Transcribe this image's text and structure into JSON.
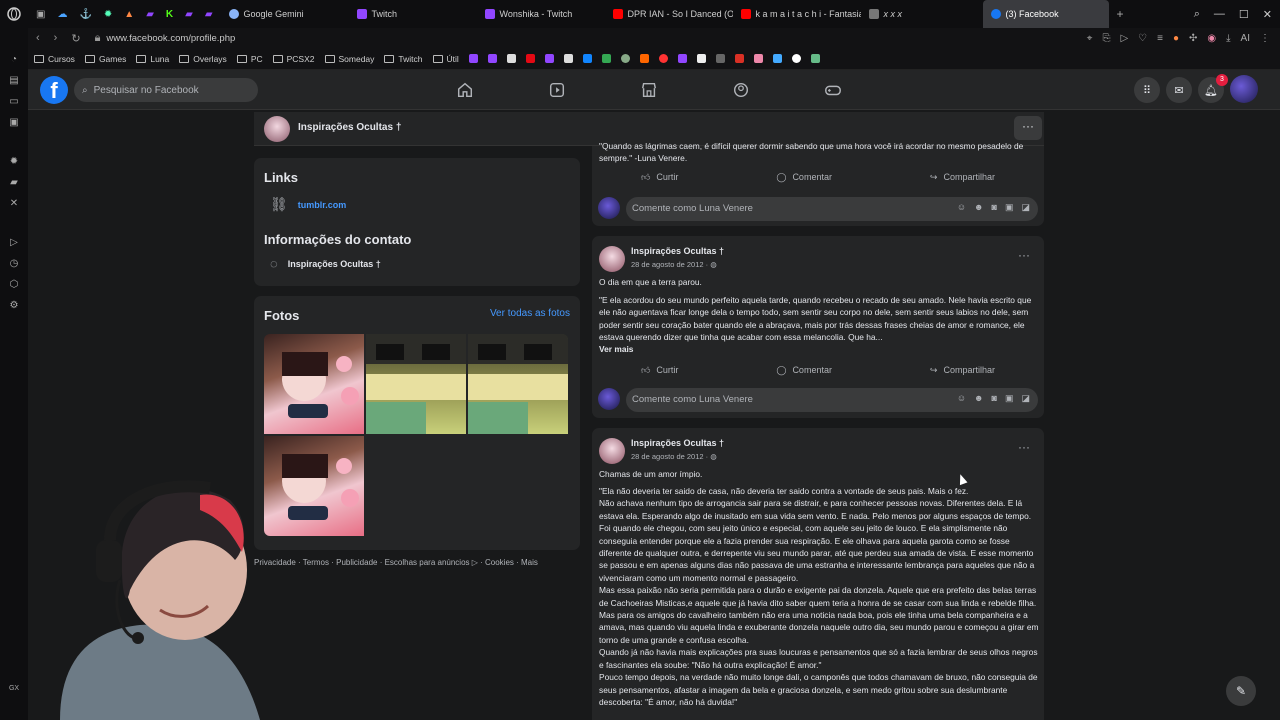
{
  "browser": {
    "tabs": [
      {
        "label": "Google Gemini",
        "color": "#8ab4f8"
      },
      {
        "label": "Twitch",
        "color": "#9146ff"
      },
      {
        "label": "Wonshika - Twitch",
        "color": "#9146ff"
      },
      {
        "label": "DPR IAN - So I Danced (O...",
        "color": "#ff0000"
      },
      {
        "label": "k a m a i t a c h i - Fantasia",
        "color": "#ff0000"
      },
      {
        "label": "x x x",
        "color": "#777777"
      },
      {
        "label": "(3) Facebook",
        "color": "#1877f2"
      }
    ],
    "url": "www.facebook.com/profile.php",
    "bookmarks": [
      "Cursos",
      "Games",
      "Luna",
      "Overlays",
      "PC",
      "PCSX2",
      "Someday",
      "Twitch",
      "Útil"
    ],
    "ai_label": "AI",
    "sidebar_label": "GX"
  },
  "facebook": {
    "search_placeholder": "Pesquisar no Facebook",
    "notification_count": "3",
    "profile_name": "Inspirações Ocultas †",
    "links": {
      "title": "Links",
      "url": "tumblr.com"
    },
    "contact": {
      "title": "Informações do contato",
      "messenger": "Inspirações Ocultas †"
    },
    "photos": {
      "title": "Fotos",
      "see_all": "Ver todas as fotos"
    },
    "footer": "Privacidade · Termos · Publicidade · Escolhas para anúncios ▷ · Cookies · Mais",
    "actions": {
      "like": "Curtir",
      "comment": "Comentar",
      "share": "Compartilhar"
    },
    "comment_placeholder": "Comente como Luna Venere",
    "posts": [
      {
        "text": "\"Quando as lágrimas caem, é difícil querer dormir sabendo que uma hora você irá acordar no mesmo pesadelo de sempre.\" -Luna Venere."
      },
      {
        "author": "Inspirações Ocultas †",
        "date": "28 de agosto de 2012 ·",
        "title": "O dia em que a terra parou.",
        "body": "\"E ela acordou do seu mundo perfeito aquela tarde, quando recebeu o recado de seu amado. Nele havia escrito que ele não aguentava ficar longe dela o tempo todo, sem sentir seu corpo no dele, sem sentir seus labios no dele, sem poder sentir seu coração bater quando ele a abraçava, mais por trás dessas frases cheias de amor e romance, ele estava querendo dizer que tinha que acabar com essa melancolia. Que ha...",
        "see_more": "Ver mais"
      },
      {
        "author": "Inspirações Ocultas †",
        "date": "28 de agosto de 2012 ·",
        "title": "Chamas de um amor ímpio.",
        "paragraphs": [
          "\"Ela não deveria ter saido de casa, não deveria ter saido contra a vontade de seus pais. Mais o fez.",
          "Não achava nenhum tipo de arrogancia sair para se distrair, e para conhecer pessoas novas. Diferentes dela. E lá estava ela. Esperando algo de inusitado em sua vida sem vento. E nada. Pelo menos por alguns espaços de tempo. Foi quando ele chegou, com seu jeito único e especial, com aquele seu jeito de louco. E ela simplismente não conseguia entender porque ele a fazia prender sua respiração. E ele olhava para aquela garota como se fosse diferente de qualquer outra, e derrepente viu seu mundo parar, até que perdeu sua amada de vista. E esse momento se passou e em apenas alguns dias não passava de uma estranha e interessante lembrança para aqueles que não a vivenciaram como um momento normal e passageiro.",
          "Mas essa paixão não seria permitida para o durão e exigente pai da donzela. Aquele que era prefeito das belas terras de Cachoeiras Misticas,e aquele que já havia dito saber quem teria a honra de se casar com sua linda e rebelde filha. Mas para os amigos do cavalheiro também não era uma noticia nada boa, pois ele tinha uma bela companheira e a amava, mas quando viu aquela linda e exuberante donzela naquele outro dia, seu mundo parou e começou a girar em torno de uma grande e confusa escolha.",
          "Quando já não havia mais explicações pra suas loucuras e pensamentos que só a fazia lembrar de seus olhos negros e fascinantes ela soube: \"Não há outra explicação! É amor.\"",
          "Pouco tempo depois, na verdade não muito longe dali, o camponês que todos chamavam de bruxo, não conseguia de seus pensamentos, afastar a imagem da bela e graciosa donzela, e sem medo gritou sobre sua deslumbrante descoberta: \"É amor, não há duvida!\""
        ]
      }
    ]
  }
}
